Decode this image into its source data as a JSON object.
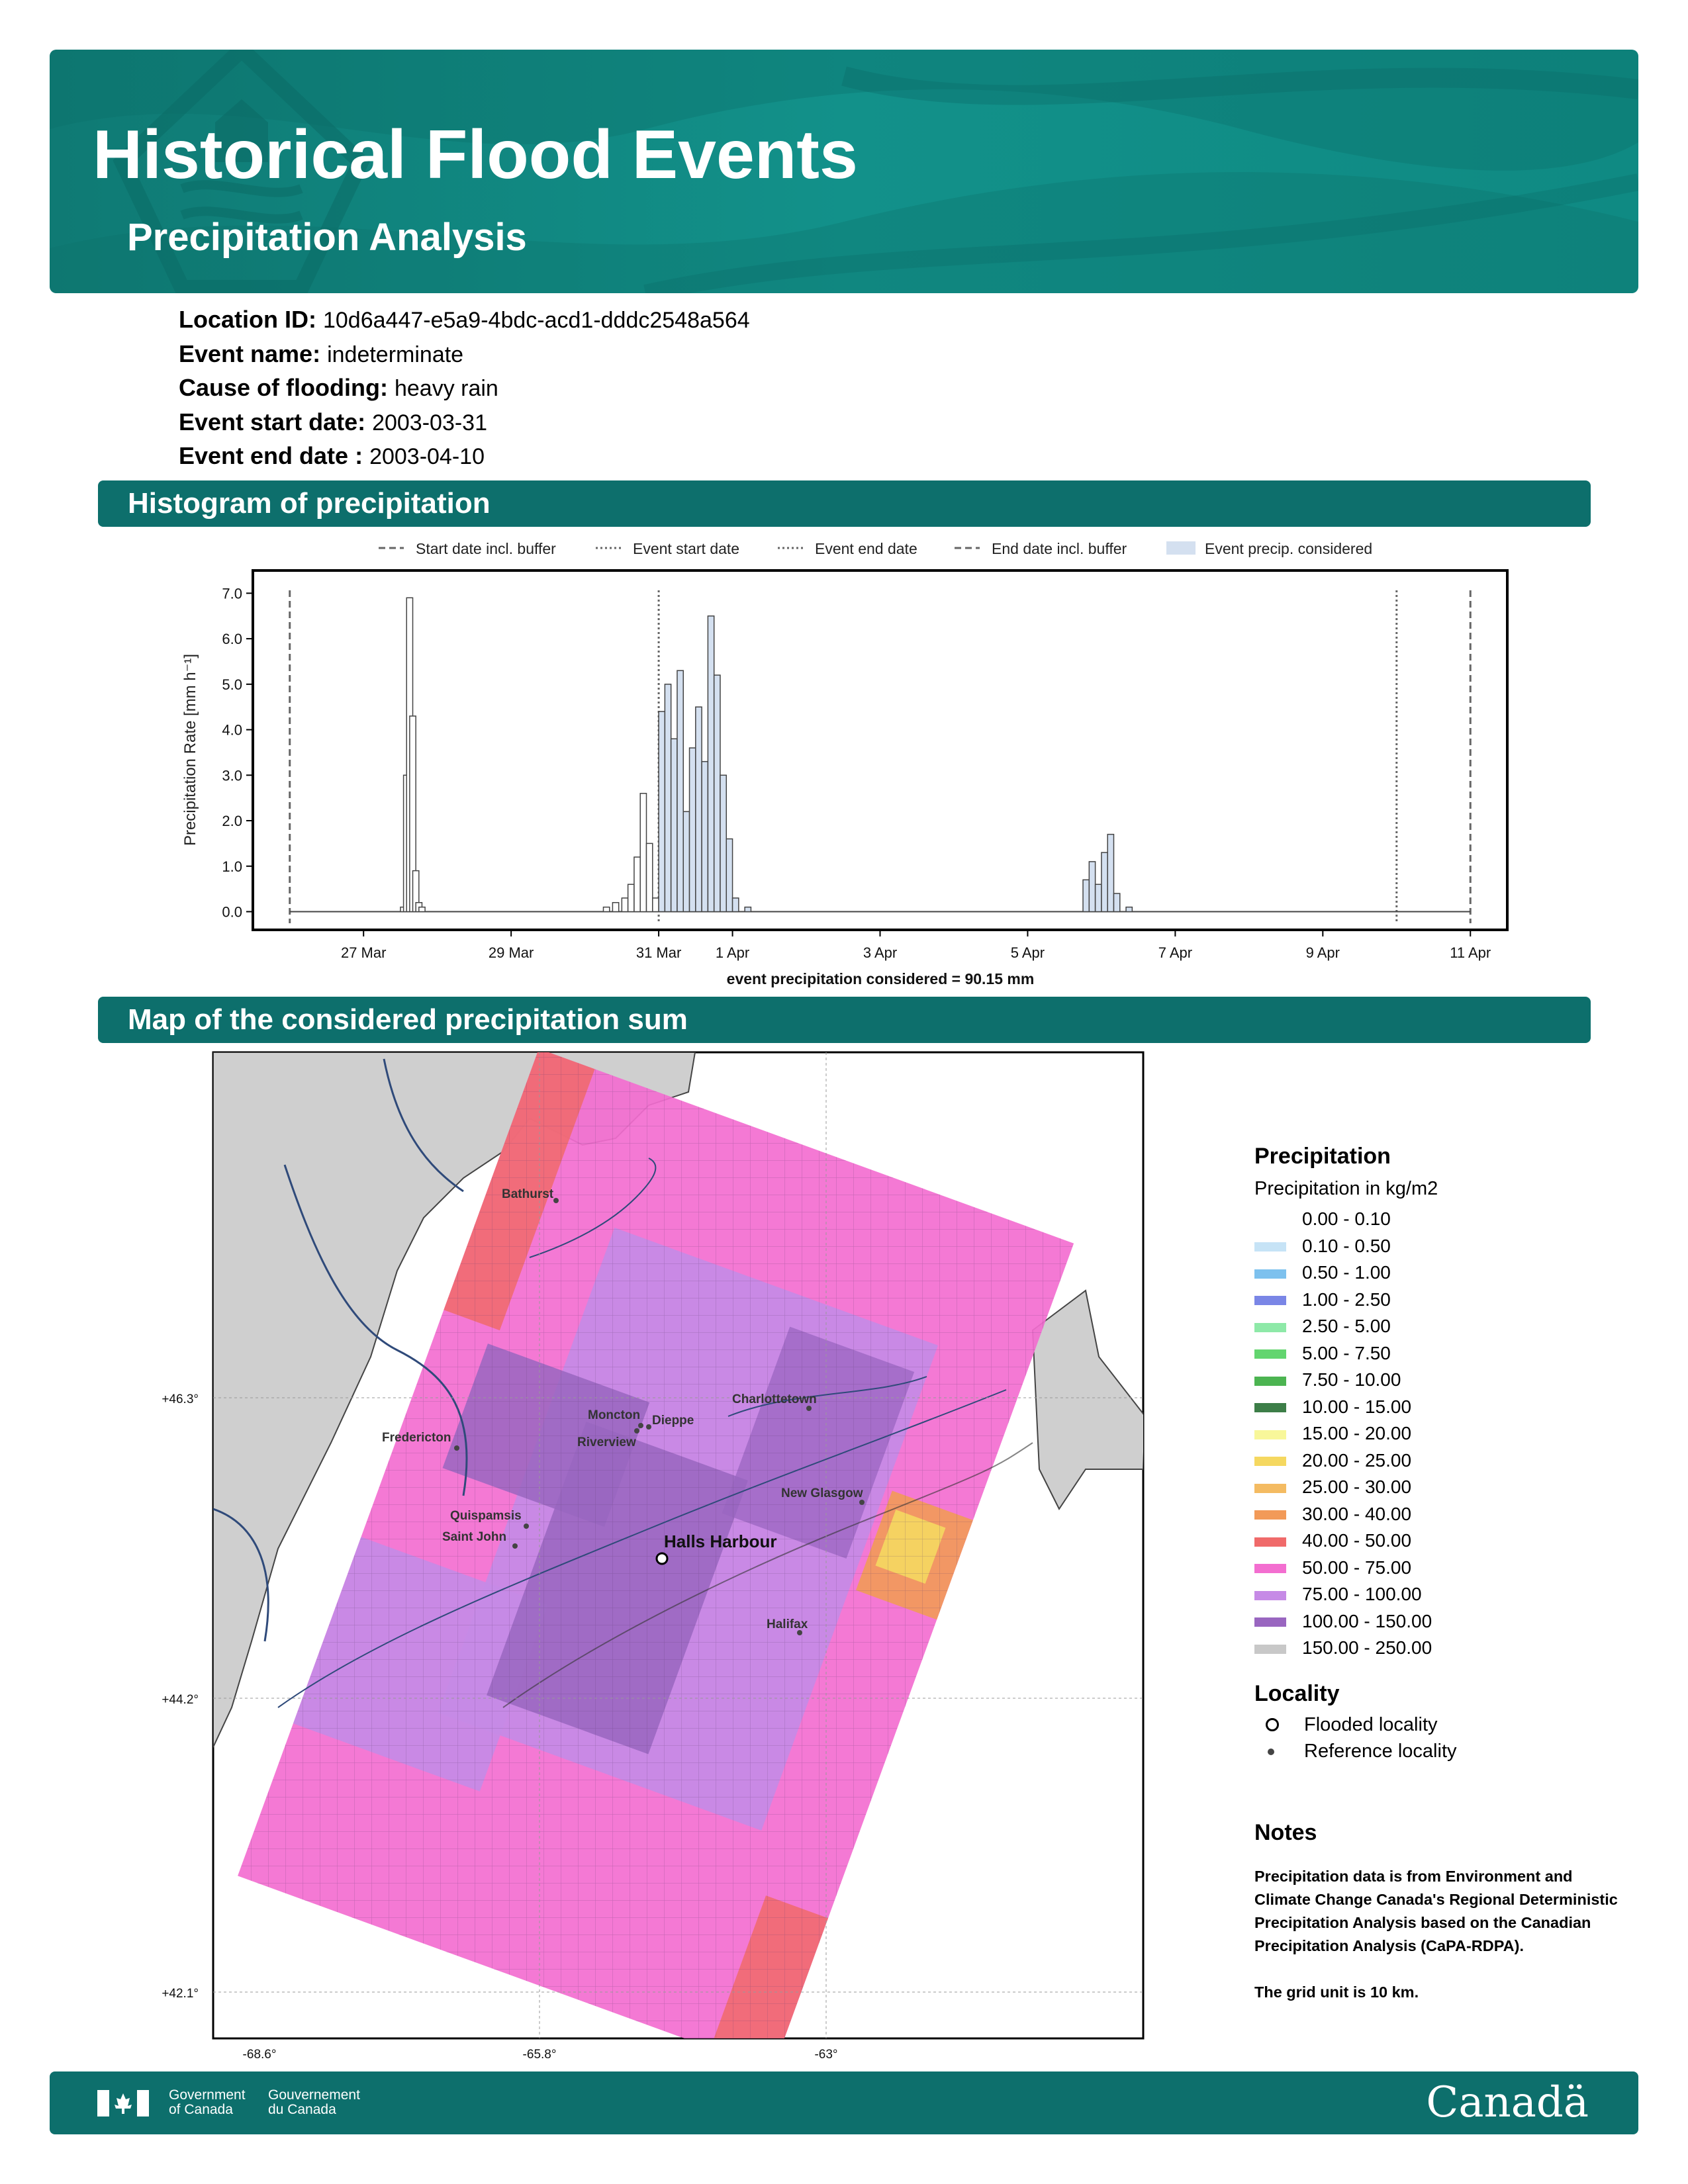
{
  "header": {
    "title": "Historical Flood Events",
    "subtitle": "Precipitation Analysis"
  },
  "event": {
    "location_label": "Location ID:",
    "location_value": "10d6a447-e5a9-4bdc-acd1-dddc2548a564",
    "name_label": "Event name:",
    "name_value": "indeterminate",
    "cause_label": "Cause of flooding:",
    "cause_value": "heavy rain",
    "start_label": "Event start date:",
    "start_value": "2003-03-31",
    "end_label": "Event end date :",
    "end_value": "2003-04-10"
  },
  "sections": {
    "histogram": "Histogram of precipitation",
    "map": "Map of the considered precipitation sum"
  },
  "chart_data": {
    "type": "area",
    "ylabel": "Precipitation Rate [mm h⁻¹]",
    "ylim": [
      -0.4,
      7.5
    ],
    "yticks": [
      "0.0",
      "1.0",
      "2.0",
      "3.0",
      "4.0",
      "5.0",
      "6.0",
      "7.0"
    ],
    "xticks": [
      "27 Mar",
      "29 Mar",
      "31 Mar",
      "1 Apr",
      "3 Apr",
      "5 Apr",
      "7 Apr",
      "9 Apr",
      "11 Apr"
    ],
    "xlim": [
      "2003-03-25T12:00",
      "2003-04-11T12:00"
    ],
    "caption": "event precipitation considered = 90.15 mm",
    "legend": [
      "Start date incl. buffer",
      "Event start date",
      "Event end date",
      "End date incl. buffer",
      "Event precip. considered"
    ],
    "markers": {
      "start_buffer": "2003-03-26T00:00",
      "event_start": "2003-03-31T00:00",
      "event_end": "2003-04-10T00:00",
      "end_buffer": "2003-04-11T00:00"
    },
    "x": [
      "2003-03-27T12:00",
      "2003-03-27T13:00",
      "2003-03-27T14:00",
      "2003-03-27T15:00",
      "2003-03-27T16:00",
      "2003-03-27T17:00",
      "2003-03-27T18:00",
      "2003-03-30T06:00",
      "2003-03-30T09:00",
      "2003-03-30T12:00",
      "2003-03-30T14:00",
      "2003-03-30T16:00",
      "2003-03-30T18:00",
      "2003-03-30T20:00",
      "2003-03-30T22:00",
      "2003-03-31T00:00",
      "2003-03-31T02:00",
      "2003-03-31T04:00",
      "2003-03-31T06:00",
      "2003-03-31T08:00",
      "2003-03-31T10:00",
      "2003-03-31T12:00",
      "2003-03-31T14:00",
      "2003-03-31T16:00",
      "2003-03-31T18:00",
      "2003-03-31T20:00",
      "2003-03-31T22:00",
      "2003-04-01T00:00",
      "2003-04-01T04:00",
      "2003-04-01T10:00",
      "2003-04-05T18:00",
      "2003-04-05T20:00",
      "2003-04-05T22:00",
      "2003-04-06T00:00",
      "2003-04-06T02:00",
      "2003-04-06T04:00",
      "2003-04-06T08:00",
      "2003-04-06T14:00"
    ],
    "values": [
      0.1,
      3.0,
      6.9,
      4.3,
      0.9,
      0.2,
      0.1,
      0.1,
      0.2,
      0.3,
      0.6,
      1.2,
      2.6,
      1.5,
      0.3,
      4.4,
      5.0,
      3.8,
      5.3,
      2.2,
      3.6,
      4.5,
      3.3,
      6.5,
      5.2,
      3.0,
      1.6,
      0.3,
      0.1,
      0.0,
      0.7,
      1.1,
      0.6,
      1.3,
      1.7,
      0.4,
      0.1,
      0.0
    ]
  },
  "map": {
    "lat_labels": [
      "+46.3°",
      "+44.2°",
      "+42.1°"
    ],
    "lon_labels": [
      "-68.6°",
      "-65.8°",
      "-63°"
    ],
    "flooded": "Halls Harbour",
    "reference": [
      "Bathurst",
      "Fredericton",
      "Moncton",
      "Dieppe",
      "Riverview",
      "Charlottetown",
      "New Glasgow",
      "Quispamsis",
      "Saint John",
      "Halifax"
    ]
  },
  "legend": {
    "title": "Precipitation",
    "subtitle": "Precipitation in kg/m2",
    "ranges": [
      {
        "label": "0.00 - 0.10",
        "color": "#ffffff"
      },
      {
        "label": "0.10 - 0.50",
        "color": "#c6e3f6"
      },
      {
        "label": "0.50 - 1.00",
        "color": "#7dc1ee"
      },
      {
        "label": "1.00 - 2.50",
        "color": "#7a86e6"
      },
      {
        "label": "2.50 - 5.00",
        "color": "#8ee9a8"
      },
      {
        "label": "5.00 - 7.50",
        "color": "#63d56f"
      },
      {
        "label": "7.50 - 10.00",
        "color": "#4cb451"
      },
      {
        "label": "10.00 - 15.00",
        "color": "#3d7e48"
      },
      {
        "label": "15.00 - 20.00",
        "color": "#f8f79a"
      },
      {
        "label": "20.00 - 25.00",
        "color": "#f5d860"
      },
      {
        "label": "25.00 - 30.00",
        "color": "#f4bb62"
      },
      {
        "label": "30.00 - 40.00",
        "color": "#f29a58"
      },
      {
        "label": "40.00 - 50.00",
        "color": "#f06a6a"
      },
      {
        "label": "50.00 - 75.00",
        "color": "#f36ed0"
      },
      {
        "label": "75.00 - 100.00",
        "color": "#c68ae6"
      },
      {
        "label": "100.00 - 150.00",
        "color": "#9966c0"
      },
      {
        "label": "150.00 - 250.00",
        "color": "#c8c8c8"
      }
    ],
    "locality_title": "Locality",
    "flooded_label": "Flooded locality",
    "reference_label": "Reference locality"
  },
  "notes": {
    "title": "Notes",
    "line1": "Precipitation data is from Environment and Climate Change Canada's Regional Deterministic Precipitation Analysis based on the Canadian Precipitation Analysis (CaPA-RDPA).",
    "line2": "The grid unit is 10 km."
  },
  "footer": {
    "gov_en_1": "Government",
    "gov_en_2": "of Canada",
    "gov_fr_1": "Gouvernement",
    "gov_fr_2": "du Canada",
    "wordmark": "Canadä"
  }
}
